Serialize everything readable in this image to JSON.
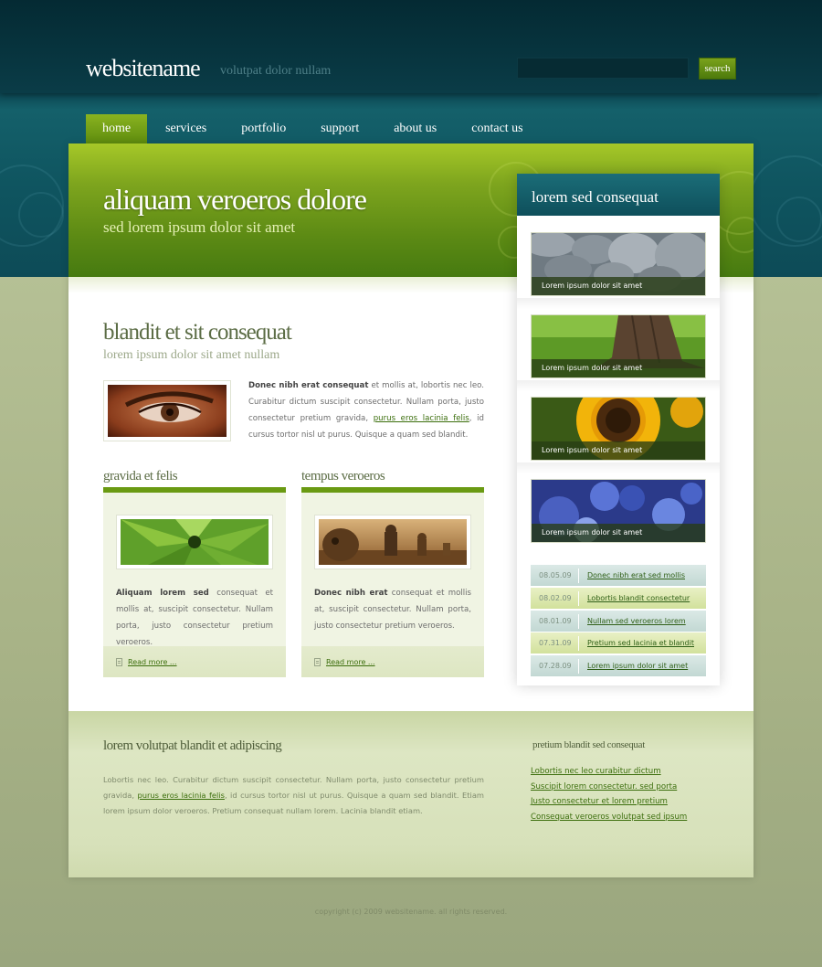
{
  "header": {
    "logo": "websitename",
    "tagline": "volutpat dolor nullam",
    "search_value": "",
    "search_button": "search"
  },
  "nav": {
    "items": [
      "home",
      "services",
      "portfolio",
      "support",
      "about us",
      "contact us"
    ],
    "active": "home"
  },
  "banner": {
    "title": "aliquam veroeros dolore",
    "subtitle": "sed lorem ipsum dolor sit amet"
  },
  "main": {
    "title": "blandit et sit consequat",
    "subtitle": "lorem ipsum dolor sit amet nullam",
    "intro_bold": "Donec nibh erat consequat",
    "intro_part1": " et mollis at, lobortis nec leo. Curabitur dictum suscipit consectetur. Nullam porta, justo consectetur pretium gravida, ",
    "intro_link": "purus eros lacinia felis",
    "intro_part2": ", id cursus tortor nisl ut purus. Quisque a quam sed blandit."
  },
  "boxes": [
    {
      "title": "gravida et felis",
      "bold": "Aliquam lorem sed",
      "text": " consequat et mollis at, suscipit consectetur. Nullam porta, justo consectetur pretium veroeros.",
      "read_more": "Read more ..."
    },
    {
      "title": "tempus veroeros",
      "bold": "Donec nibh erat",
      "text": " consequat et mollis at, suscipit consectetur. Nullam porta, justo consectetur pretium veroeros.",
      "read_more": "Read more ..."
    }
  ],
  "sidebar": {
    "title": "lorem sed consequat",
    "thumbs": [
      {
        "caption": "Lorem ipsum dolor sit amet"
      },
      {
        "caption": "Lorem ipsum dolor sit amet"
      },
      {
        "caption": "Lorem ipsum dolor sit amet"
      },
      {
        "caption": "Lorem ipsum dolor sit amet"
      }
    ],
    "news": [
      {
        "date": "08.05.09",
        "title": "Donec nibh erat sed mollis"
      },
      {
        "date": "08.02.09",
        "title": "Lobortis blandit consectetur"
      },
      {
        "date": "08.01.09",
        "title": "Nullam sed veroeros lorem"
      },
      {
        "date": "07.31.09",
        "title": "Pretium sed lacinia et blandit"
      },
      {
        "date": "07.28.09",
        "title": "Lorem ipsum dolor sit amet"
      }
    ]
  },
  "footer": {
    "title": "lorem volutpat blandit et adipiscing",
    "text_part1": "Lobortis nec leo. Curabitur dictum suscipit consectetur. Nullam porta, justo consectetur pretium gravida, ",
    "text_link": "purus eros lacinia felis",
    "text_part2": ", id cursus tortor nisl ut purus. Quisque a quam sed blandit. Etiam lorem ipsum dolor veroeros. Pretium consequat nullam lorem. Lacinia blandit etiam.",
    "links_title": "pretium blandit sed consequat",
    "links": [
      "Lobortis nec leo curabitur dictum",
      "Suscipit lorem consectetur. sed porta",
      "Justo consectetur et lorem pretium",
      "Consequat veroeros volutpat sed ipsum"
    ],
    "copyright": "copyright (c) 2009 websitename. all rights reserved."
  },
  "colors": {
    "header_teal": "#0b4450",
    "banner_green": "#7ea51e",
    "accent_green": "#6a9a12",
    "link_green": "#3b6e0c",
    "page_bg": "#a8b387"
  }
}
